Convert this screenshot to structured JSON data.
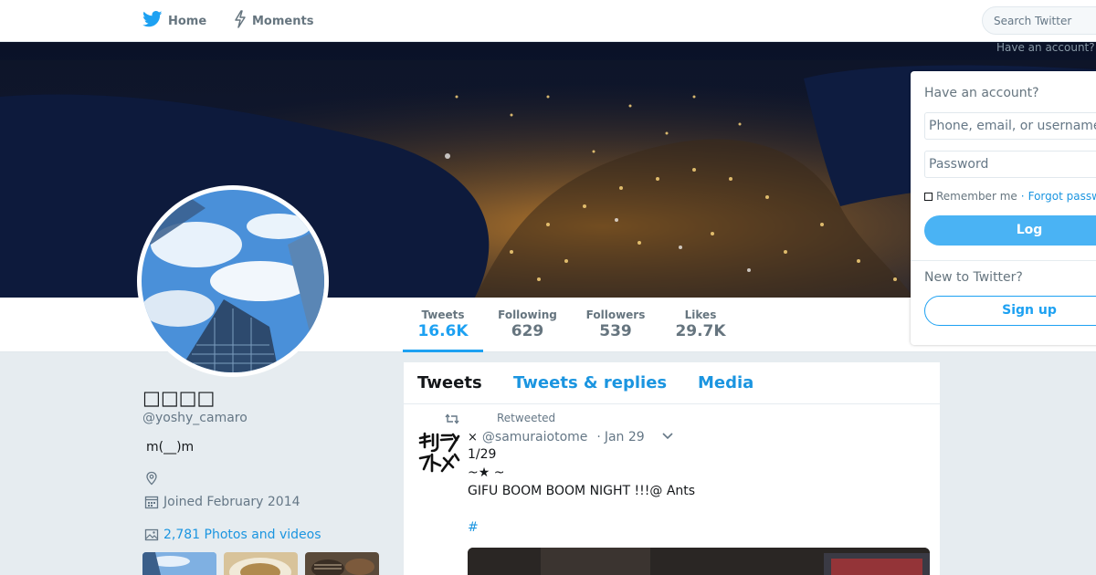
{
  "nav": {
    "home_label": "Home",
    "moments_label": "Moments",
    "search_placeholder": "Search Twitter",
    "have_account_link": "Have an account?"
  },
  "profile": {
    "display_name": "□□□□",
    "handle": "@yoshy_camaro",
    "bio": "m(__)m",
    "joined": "Joined February 2014",
    "photos_link": "2,781 Photos and videos"
  },
  "stats": [
    {
      "label": "Tweets",
      "value": "16.6K"
    },
    {
      "label": "Following",
      "value": "629"
    },
    {
      "label": "Followers",
      "value": "539"
    },
    {
      "label": "Likes",
      "value": "29.7K"
    }
  ],
  "timeline": {
    "tabs": [
      "Tweets",
      "Tweets & replies",
      "Media"
    ],
    "tweet": {
      "retweet_label": "Retweeted",
      "author_mark": "×",
      "author_handle": "@samuraiotome",
      "separator": "·",
      "date": "Jan 29",
      "lines": [
        "1/29",
        "~★ ~",
        "GIFU BOOM BOOM NIGHT !!!@  Ants"
      ],
      "hashtag": "#"
    }
  },
  "login": {
    "heading": "Have an account?",
    "username_placeholder": "Phone, email, or username",
    "password_placeholder": "Password",
    "remember_me": "Remember me",
    "separator": "·",
    "forgot_link": "Forgot password?",
    "login_button": "Log in",
    "new_heading": "New to Twitter?",
    "signup_button": "Sign up"
  },
  "colors": {
    "accent": "#1da1f2",
    "link": "#1b95e0",
    "background": "#e6ecf0"
  }
}
